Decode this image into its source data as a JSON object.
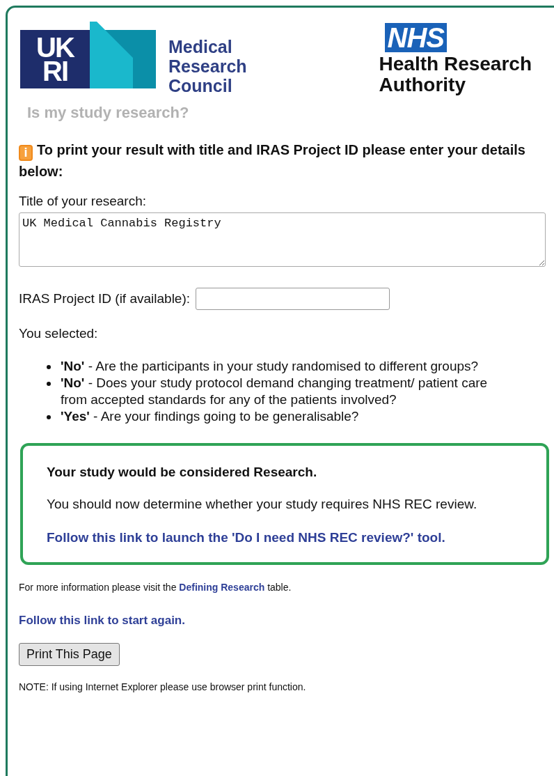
{
  "logos": {
    "ukri_top": "UK",
    "ukri_bottom": "RI",
    "council": [
      "Medical",
      "Research",
      "Council"
    ],
    "nhs": "NHS",
    "authority": [
      "Health Research",
      "Authority"
    ]
  },
  "page_title": "Is my study research?",
  "notice": {
    "icon": "i",
    "text": "To print your result with title and IRAS Project ID please enter your details below:"
  },
  "title_field": {
    "label": "Title of your research:",
    "value": "UK Medical Cannabis Registry"
  },
  "iras_field": {
    "label": "IRAS Project ID (if available):"
  },
  "selected_label": "You selected:",
  "answers": [
    {
      "text": "**'No'** - Are the participants in your study randomised to different groups?"
    },
    {
      "text": "**'No'** - Does your study protocol demand changing treatment/ patient care from accepted standards for any of the patients involved?"
    },
    {
      "text": "**'Yes'** - Are your findings going to be generalisable?"
    }
  ],
  "result": {
    "heading": "Your study would be considered Research.",
    "body": "You should now determine whether your study requires NHS REC review.",
    "link": "Follow this link to launch the 'Do I need NHS REC review?' tool."
  },
  "more_info": {
    "before": "For more information please visit the",
    "link": "Defining Research",
    "after": "table."
  },
  "start_again": "Follow this link to start again.",
  "print_button": "Print This Page",
  "note": "NOTE: If using Internet Explorer please use browser print function."
}
